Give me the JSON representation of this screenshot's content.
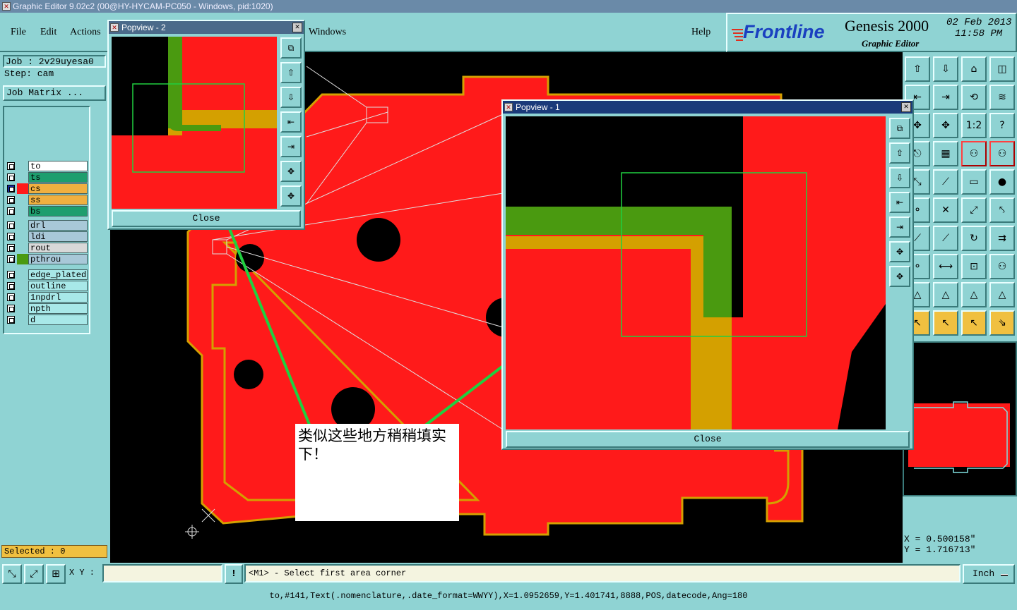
{
  "window": {
    "title": "Graphic Editor 9.02c2 (00@HY-HYCAM-PC050 - Windows, pid:1020)"
  },
  "menu": {
    "file": "File",
    "edit": "Edit",
    "actions": "Actions",
    "windows": "Windows",
    "help": "Help"
  },
  "brand": {
    "logo": "Frontline",
    "product": "Genesis 2000",
    "subtitle": "Graphic Editor",
    "date": "02 Feb 2013",
    "time": "11:58 PM"
  },
  "job": {
    "job_label": "Job : 2v29uyesa0",
    "step_label": "Step: cam",
    "matrix_button": "Job Matrix ..."
  },
  "layers": [
    {
      "name": "to",
      "color": "#ffffff"
    },
    {
      "name": "ts",
      "color": "#1e9e6e"
    },
    {
      "name": "cs",
      "color": "#f0b040"
    },
    {
      "name": "ss",
      "color": "#f0b040"
    },
    {
      "name": "bs",
      "color": "#1e9e6e"
    },
    {
      "name": "drl",
      "color": "#a8c8d8"
    },
    {
      "name": "ldi",
      "color": "#a8c8d8"
    },
    {
      "name": "rout",
      "color": "#d8d8d8"
    },
    {
      "name": "pthrou",
      "color": "#a8c8d8"
    },
    {
      "name": "edge_plated",
      "color": "#a8e8e8"
    },
    {
      "name": "outline",
      "color": "#a8e8e8"
    },
    {
      "name": "1npdrl",
      "color": "#a8e8e8"
    },
    {
      "name": "npth",
      "color": "#a8e8e8"
    },
    {
      "name": "d",
      "color": "#a8e8e8"
    }
  ],
  "selected": "Selected : 0",
  "popview2": {
    "title": "Popview - 2",
    "close": "Close"
  },
  "popview1": {
    "title": "Popview - 1",
    "close": "Close"
  },
  "note": "类似这些地方稍稍填实下！",
  "coords": {
    "x": "X = 0.500158\"",
    "y": "Y = 1.716713\""
  },
  "status": {
    "xy_label": "X Y :",
    "xy_value": "",
    "message": "<M1> - Select first area corner",
    "units": "Inch"
  },
  "info": "to,#141,Text(.nomenclature,.date_format=WWYY),X=1.0952659,Y=1.401741,8888,POS,datecode,Ang=180",
  "colors": {
    "panel": "#8fd3d3",
    "copper": "#ff1a1a",
    "silk": "#d4a000",
    "mask": "#4a9a10"
  }
}
